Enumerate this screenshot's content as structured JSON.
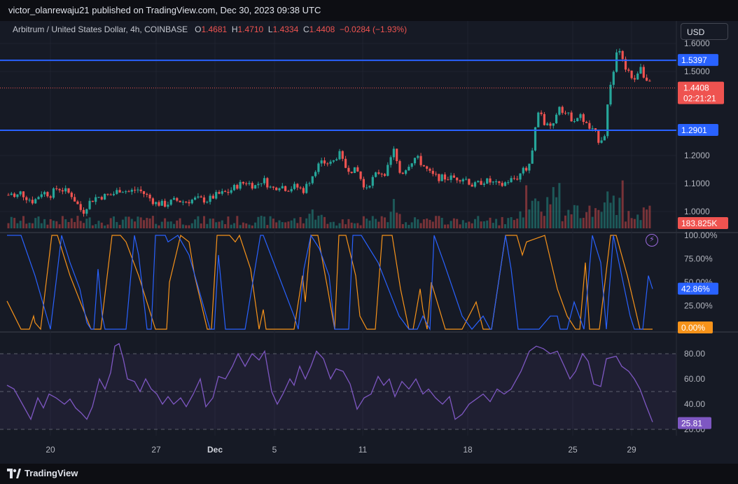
{
  "publisher": "victor_olanrewaju21 published on TradingView.com, Dec 30, 2023 09:38 UTC",
  "legend": {
    "title": "Arbitrum / United States Dollar, 4h, COINBASE",
    "open_label": "O",
    "open": "1.4681",
    "high_label": "H",
    "high": "1.4710",
    "low_label": "L",
    "low": "1.4334",
    "close_label": "C",
    "close": "1.4408",
    "change": "−0.0284 (−1.93%)"
  },
  "currency_button": "USD",
  "brand": "TradingView",
  "colors": {
    "up": "#26a69a",
    "down": "#ef5350",
    "level_line": "#2962ff",
    "aroon_up": "#f7931a",
    "aroon_down": "#2962ff",
    "rsi": "#7e57c2",
    "background": "#161a25"
  },
  "chart_data": [
    {
      "type": "candlestick",
      "pair": "Arbitrum / United States Dollar",
      "timeframe": "4h",
      "exchange": "COINBASE",
      "ylim": [
        0.94,
        1.66
      ],
      "y_ticks": [
        "1.6000",
        "1.5000",
        "1.2000",
        "1.1000",
        "1.0000"
      ],
      "x_ticks": [
        "20",
        "27",
        "Dec",
        "5",
        "11",
        "18",
        "25",
        "29"
      ],
      "horizontal_levels": [
        1.5397,
        1.2901
      ],
      "last_price": "1.4408",
      "countdown": "02:21:21",
      "level_labels": [
        "1.5397",
        "1.2901"
      ],
      "volume_label": "183.825K",
      "price_path": [
        [
          0,
          1.09
        ],
        [
          8,
          1.045
        ],
        [
          15,
          1.07
        ],
        [
          22,
          1.045
        ],
        [
          28,
          1.07
        ],
        [
          38,
          1.05
        ],
        [
          48,
          1.035
        ],
        [
          60,
          1.07
        ],
        [
          72,
          1.06
        ],
        [
          82,
          1.085
        ],
        [
          92,
          1.075
        ],
        [
          102,
          1.06
        ],
        [
          112,
          1.02
        ],
        [
          118,
          0.995
        ],
        [
          126,
          1.03
        ],
        [
          136,
          1.05
        ],
        [
          148,
          1.055
        ],
        [
          160,
          1.06
        ],
        [
          172,
          1.08
        ],
        [
          184,
          1.07
        ],
        [
          196,
          1.08
        ],
        [
          208,
          1.06
        ],
        [
          222,
          1.03
        ],
        [
          236,
          1.025
        ],
        [
          250,
          1.04
        ],
        [
          264,
          1.035
        ],
        [
          280,
          1.045
        ],
        [
          296,
          1.04
        ],
        [
          310,
          1.06
        ],
        [
          326,
          1.07
        ],
        [
          340,
          1.095
        ],
        [
          352,
          1.105
        ],
        [
          364,
          1.09
        ],
        [
          376,
          1.115
        ],
        [
          388,
          1.08
        ],
        [
          400,
          1.095
        ],
        [
          410,
          1.08
        ],
        [
          422,
          1.09
        ],
        [
          434,
          1.075
        ],
        [
          444,
          1.12
        ],
        [
          452,
          1.16
        ],
        [
          462,
          1.175
        ],
        [
          474,
          1.17
        ],
        [
          484,
          1.21
        ],
        [
          492,
          1.16
        ],
        [
          502,
          1.15
        ],
        [
          512,
          1.14
        ],
        [
          520,
          1.08
        ],
        [
          530,
          1.11
        ],
        [
          540,
          1.14
        ],
        [
          552,
          1.14
        ],
        [
          562,
          1.22
        ],
        [
          572,
          1.13
        ],
        [
          584,
          1.17
        ],
        [
          594,
          1.195
        ],
        [
          606,
          1.16
        ],
        [
          616,
          1.13
        ],
        [
          628,
          1.12
        ],
        [
          640,
          1.12
        ],
        [
          652,
          1.12
        ],
        [
          664,
          1.12
        ],
        [
          676,
          1.09
        ],
        [
          690,
          1.11
        ],
        [
          702,
          1.105
        ],
        [
          714,
          1.09
        ],
        [
          726,
          1.11
        ],
        [
          738,
          1.12
        ],
        [
          748,
          1.15
        ],
        [
          756,
          1.16
        ],
        [
          762,
          1.26
        ],
        [
          770,
          1.37
        ],
        [
          778,
          1.31
        ],
        [
          788,
          1.29
        ],
        [
          798,
          1.38
        ],
        [
          808,
          1.35
        ],
        [
          818,
          1.33
        ],
        [
          830,
          1.34
        ],
        [
          840,
          1.3
        ],
        [
          850,
          1.28
        ],
        [
          856,
          1.25
        ],
        [
          864,
          1.28
        ],
        [
          870,
          1.43
        ],
        [
          876,
          1.48
        ],
        [
          882,
          1.61
        ],
        [
          890,
          1.53
        ],
        [
          898,
          1.5
        ],
        [
          906,
          1.46
        ],
        [
          914,
          1.53
        ],
        [
          922,
          1.47
        ],
        [
          932,
          1.44
        ]
      ]
    },
    {
      "type": "line",
      "indicator": "aroon",
      "ylim": [
        0,
        100
      ],
      "y_ticks": [
        "100.00%",
        "75.00%",
        "50.00%",
        "25.00%"
      ],
      "series": [
        {
          "values_label": "42.86%"
        },
        {
          "values_label": "0.00%"
        }
      ],
      "aroon_up_points": [
        [
          10,
          30
        ],
        [
          30,
          0
        ],
        [
          42,
          0
        ],
        [
          48,
          14
        ],
        [
          50,
          7
        ],
        [
          58,
          0
        ],
        [
          74,
          100
        ],
        [
          82,
          100
        ],
        [
          100,
          57
        ],
        [
          130,
          0
        ],
        [
          144,
          0
        ],
        [
          160,
          100
        ],
        [
          172,
          100
        ],
        [
          180,
          93
        ],
        [
          198,
          57
        ],
        [
          222,
          0
        ],
        [
          238,
          0
        ],
        [
          242,
          50
        ],
        [
          258,
          100
        ],
        [
          270,
          93
        ],
        [
          278,
          57
        ],
        [
          296,
          0
        ],
        [
          302,
          0
        ],
        [
          310,
          100
        ],
        [
          318,
          100
        ],
        [
          328,
          100
        ],
        [
          336,
          93
        ],
        [
          342,
          100
        ],
        [
          358,
          64
        ],
        [
          370,
          0
        ],
        [
          376,
          21
        ],
        [
          380,
          0
        ],
        [
          388,
          0
        ],
        [
          420,
          0
        ],
        [
          432,
          57
        ],
        [
          436,
          29
        ],
        [
          444,
          100
        ],
        [
          454,
          100
        ],
        [
          468,
          43
        ],
        [
          478,
          0
        ],
        [
          484,
          100
        ],
        [
          494,
          100
        ],
        [
          508,
          57
        ],
        [
          514,
          14
        ],
        [
          524,
          0
        ],
        [
          536,
          0
        ],
        [
          546,
          100
        ],
        [
          560,
          100
        ],
        [
          572,
          43
        ],
        [
          584,
          0
        ],
        [
          590,
          0
        ],
        [
          600,
          43
        ],
        [
          604,
          21
        ],
        [
          610,
          0
        ],
        [
          616,
          50
        ],
        [
          636,
          0
        ],
        [
          648,
          0
        ],
        [
          660,
          0
        ],
        [
          680,
          29
        ],
        [
          690,
          0
        ],
        [
          702,
          0
        ],
        [
          722,
          100
        ],
        [
          738,
          100
        ],
        [
          746,
          79
        ],
        [
          752,
          93
        ],
        [
          778,
          100
        ],
        [
          796,
          43
        ],
        [
          810,
          14
        ],
        [
          822,
          0
        ],
        [
          828,
          0
        ],
        [
          836,
          71
        ],
        [
          842,
          0
        ],
        [
          856,
          0
        ],
        [
          872,
          100
        ],
        [
          880,
          100
        ],
        [
          896,
          57
        ],
        [
          914,
          0
        ],
        [
          922,
          0
        ],
        [
          932,
          0
        ]
      ],
      "aroon_down_points": [
        [
          10,
          100
        ],
        [
          30,
          100
        ],
        [
          50,
          57
        ],
        [
          72,
          0
        ],
        [
          88,
          100
        ],
        [
          100,
          71
        ],
        [
          114,
          43
        ],
        [
          124,
          7
        ],
        [
          130,
          0
        ],
        [
          134,
          0
        ],
        [
          140,
          64
        ],
        [
          146,
          14
        ],
        [
          150,
          0
        ],
        [
          180,
          0
        ],
        [
          192,
          100
        ],
        [
          198,
          79
        ],
        [
          210,
          0
        ],
        [
          216,
          0
        ],
        [
          222,
          100
        ],
        [
          236,
          100
        ],
        [
          240,
          93
        ],
        [
          254,
          100
        ],
        [
          270,
          79
        ],
        [
          300,
          0
        ],
        [
          306,
          0
        ],
        [
          312,
          79
        ],
        [
          322,
          0
        ],
        [
          350,
          0
        ],
        [
          372,
          100
        ],
        [
          376,
          100
        ],
        [
          420,
          14
        ],
        [
          426,
          0
        ],
        [
          434,
          64
        ],
        [
          444,
          100
        ],
        [
          456,
          86
        ],
        [
          470,
          57
        ],
        [
          478,
          0
        ],
        [
          498,
          0
        ],
        [
          504,
          100
        ],
        [
          516,
          100
        ],
        [
          540,
          71
        ],
        [
          570,
          14
        ],
        [
          584,
          0
        ],
        [
          596,
          0
        ],
        [
          604,
          14
        ],
        [
          614,
          0
        ],
        [
          620,
          100
        ],
        [
          634,
          71
        ],
        [
          660,
          14
        ],
        [
          674,
          0
        ],
        [
          690,
          14
        ],
        [
          700,
          0
        ],
        [
          702,
          0
        ],
        [
          722,
          100
        ],
        [
          730,
          64
        ],
        [
          740,
          0
        ],
        [
          770,
          0
        ],
        [
          786,
          14
        ],
        [
          796,
          14
        ],
        [
          800,
          0
        ],
        [
          810,
          0
        ],
        [
          820,
          29
        ],
        [
          834,
          0
        ],
        [
          846,
          100
        ],
        [
          858,
          71
        ],
        [
          866,
          0
        ],
        [
          876,
          100
        ],
        [
          884,
          71
        ],
        [
          900,
          14
        ],
        [
          906,
          0
        ],
        [
          918,
          0
        ],
        [
          926,
          57
        ],
        [
          932,
          43
        ]
      ]
    },
    {
      "type": "line",
      "indicator": "rsi",
      "ylim": [
        15,
        95
      ],
      "y_ticks": [
        "80.00",
        "60.00",
        "40.00",
        "20.00"
      ],
      "band": [
        30,
        70
      ],
      "last_value": "25.81",
      "points": [
        [
          10,
          55
        ],
        [
          20,
          52
        ],
        [
          32,
          40
        ],
        [
          44,
          28
        ],
        [
          54,
          45
        ],
        [
          62,
          37
        ],
        [
          70,
          48
        ],
        [
          80,
          45
        ],
        [
          92,
          40
        ],
        [
          100,
          44
        ],
        [
          108,
          37
        ],
        [
          116,
          33
        ],
        [
          124,
          28
        ],
        [
          132,
          38
        ],
        [
          142,
          60
        ],
        [
          150,
          52
        ],
        [
          158,
          65
        ],
        [
          164,
          86
        ],
        [
          170,
          88
        ],
        [
          176,
          76
        ],
        [
          182,
          60
        ],
        [
          192,
          58
        ],
        [
          200,
          50
        ],
        [
          208,
          60
        ],
        [
          216,
          52
        ],
        [
          224,
          48
        ],
        [
          232,
          40
        ],
        [
          240,
          46
        ],
        [
          248,
          40
        ],
        [
          258,
          45
        ],
        [
          266,
          38
        ],
        [
          276,
          48
        ],
        [
          286,
          60
        ],
        [
          294,
          38
        ],
        [
          304,
          45
        ],
        [
          312,
          62
        ],
        [
          322,
          60
        ],
        [
          332,
          70
        ],
        [
          340,
          80
        ],
        [
          350,
          70
        ],
        [
          360,
          80
        ],
        [
          370,
          75
        ],
        [
          378,
          82
        ],
        [
          388,
          50
        ],
        [
          396,
          40
        ],
        [
          404,
          48
        ],
        [
          414,
          60
        ],
        [
          420,
          55
        ],
        [
          428,
          70
        ],
        [
          436,
          60
        ],
        [
          444,
          70
        ],
        [
          452,
          82
        ],
        [
          462,
          76
        ],
        [
          472,
          60
        ],
        [
          480,
          68
        ],
        [
          490,
          66
        ],
        [
          500,
          56
        ],
        [
          510,
          36
        ],
        [
          520,
          45
        ],
        [
          530,
          48
        ],
        [
          540,
          62
        ],
        [
          548,
          55
        ],
        [
          556,
          60
        ],
        [
          564,
          46
        ],
        [
          574,
          58
        ],
        [
          584,
          52
        ],
        [
          594,
          60
        ],
        [
          604,
          48
        ],
        [
          612,
          52
        ],
        [
          622,
          45
        ],
        [
          632,
          40
        ],
        [
          642,
          46
        ],
        [
          650,
          28
        ],
        [
          660,
          32
        ],
        [
          670,
          40
        ],
        [
          680,
          44
        ],
        [
          690,
          48
        ],
        [
          700,
          42
        ],
        [
          710,
          52
        ],
        [
          720,
          48
        ],
        [
          730,
          52
        ],
        [
          744,
          66
        ],
        [
          756,
          82
        ],
        [
          766,
          86
        ],
        [
          776,
          84
        ],
        [
          786,
          80
        ],
        [
          796,
          82
        ],
        [
          806,
          70
        ],
        [
          814,
          60
        ],
        [
          822,
          66
        ],
        [
          832,
          80
        ],
        [
          840,
          74
        ],
        [
          848,
          56
        ],
        [
          858,
          54
        ],
        [
          866,
          76
        ],
        [
          880,
          78
        ],
        [
          888,
          70
        ],
        [
          898,
          66
        ],
        [
          906,
          60
        ],
        [
          914,
          52
        ],
        [
          922,
          40
        ],
        [
          932,
          25.81
        ]
      ]
    }
  ]
}
